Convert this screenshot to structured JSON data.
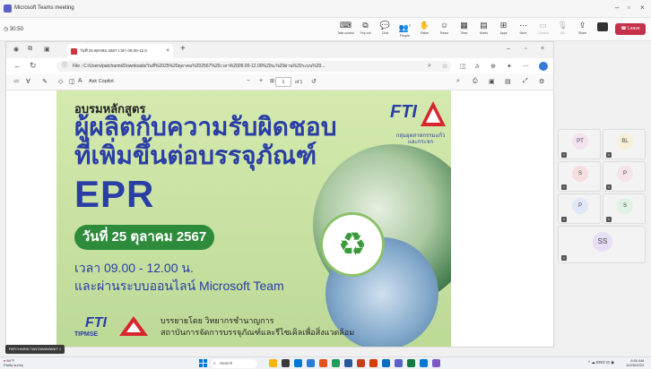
{
  "teams": {
    "window_title": "Microsoft Teams meeting",
    "timer": "30:50",
    "toolbar": [
      {
        "label": "Take control",
        "icon": "take-control-icon",
        "dim": false
      },
      {
        "label": "Pop out",
        "icon": "pop-out-icon",
        "dim": false
      },
      {
        "label": "Chat",
        "icon": "chat-icon",
        "dim": false
      },
      {
        "label": "People",
        "icon": "people-icon",
        "dim": false,
        "count": "7"
      },
      {
        "label": "Raise",
        "icon": "raise-hand-icon",
        "dim": false
      },
      {
        "label": "React",
        "icon": "react-icon",
        "dim": false
      },
      {
        "label": "View",
        "icon": "view-icon",
        "dim": false
      },
      {
        "label": "Notes",
        "icon": "notes-icon",
        "dim": false
      },
      {
        "label": "Apps",
        "icon": "apps-icon",
        "dim": false
      },
      {
        "label": "More",
        "icon": "more-icon",
        "dim": false
      },
      {
        "label": "Camera",
        "icon": "camera-icon",
        "dim": true
      },
      {
        "label": "Mic",
        "icon": "mic-icon",
        "dim": true
      },
      {
        "label": "Share",
        "icon": "share-icon",
        "dim": false
      }
    ],
    "leave_label": "Leave",
    "presenter_name": "PATCHARIN TANTAWAWANIT",
    "participants": [
      {
        "initials": "PT",
        "color": "#f3e2ef"
      },
      {
        "initials": "BL",
        "color": "#f6f0d8"
      },
      {
        "initials": "S",
        "color": "#f6dde0"
      },
      {
        "initials": "P",
        "color": "#f6e3ea"
      },
      {
        "initials": "P",
        "color": "#e0e8f6"
      },
      {
        "initials": "S",
        "color": "#dff2e3"
      }
    ],
    "big_participant": "SS"
  },
  "browser": {
    "tab_title": "วันที่ 25 ตุลาคม 2567 เวลา 09.00-12.0",
    "address_prefix": "File",
    "address": "C:/Users/patcharint/Downloads/วันที่%2025%20ตุลาคม%202567%20เวลา%2009.00-12.00%20น.%20ผ่าน%20ระบบ%20...",
    "copilot": "Ask Copilot",
    "page_current": "1",
    "page_total": "of 1"
  },
  "slide": {
    "course_label": "อบรมหลักสูตร",
    "heading_line1": "ผู้ผลิตกับความรับผิดชอบ",
    "heading_line2": "ที่เพิ่มขึ้นต่อบรรจุภัณฑ์",
    "epr": "EPR",
    "date": "วันที่ 25 ตุลาคม 2567",
    "time": "เวลา 09.00 - 12.00 น.",
    "platform": "และผ่านระบบออนไลน์ Microsoft Team",
    "lecturer": "บรรยายโดย วิทยากรชำนาญการ",
    "institute": "สถาบันการจัดการบรรจุภัณฑ์และรีไซเคิลเพื่อสิ่งแวดล้อม",
    "fti_logo_text": "FTI",
    "fti_group": "กลุ่มอุตสาหกรรมแก้วและกระจก",
    "tipmse": "TIPMSE"
  },
  "taskbar": {
    "weather_temp": "84°F",
    "weather_desc": "Partly sunny",
    "search": "Search",
    "lang": "ENG",
    "time": "8:50 AM",
    "date": "10/25/2024"
  }
}
